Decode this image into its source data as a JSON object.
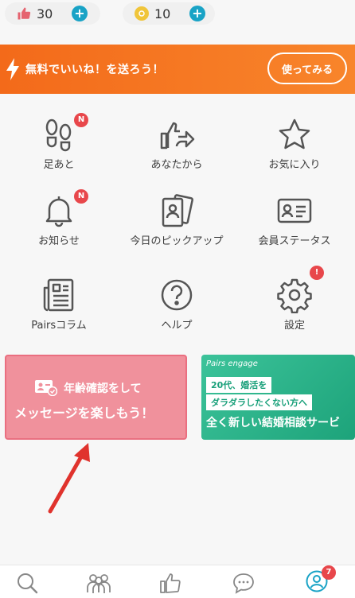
{
  "counters": {
    "likes": {
      "value": "30",
      "icon": "thumbs-up-icon"
    },
    "points": {
      "value": "10",
      "icon": "coin-icon"
    }
  },
  "banner": {
    "text": "無料でいいね！を送ろう！",
    "button_label": "使ってみる"
  },
  "menu": {
    "footprints": {
      "label": "足あと",
      "badge": "N"
    },
    "from_you": {
      "label": "あなたから"
    },
    "favorites": {
      "label": "お気に入り"
    },
    "notifications": {
      "label": "お知らせ",
      "badge": "N"
    },
    "daily_pickup": {
      "label": "今日のピックアップ"
    },
    "membership": {
      "label": "会員ステータス"
    },
    "column": {
      "label": "Pairsコラム"
    },
    "help": {
      "label": "ヘルプ"
    },
    "settings": {
      "label": "設定",
      "badge": "!"
    }
  },
  "promo_age": {
    "line1": "年齢確認をして",
    "line2": "メッセージを楽しもう！"
  },
  "promo_engage": {
    "brand": "Pairs engage",
    "tag1": "20代、婚活を",
    "tag2": "ダラダラしたくない方へ",
    "headline": "全く新しい結婚相談サービ"
  },
  "nav": {
    "profile_badge": "7"
  },
  "colors": {
    "accent_orange": "#f36a1a",
    "teal": "#19a3c6",
    "badge_red": "#e8474b",
    "promo_pink": "#f0919c",
    "promo_green": "#2bb58a"
  }
}
